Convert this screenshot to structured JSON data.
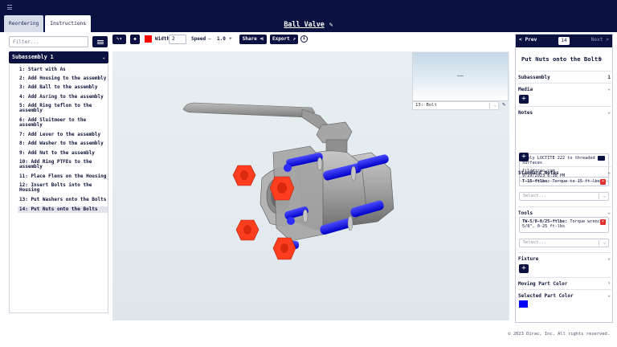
{
  "header": {
    "title": "Ball Valve",
    "tabs": [
      {
        "label": "Reordering",
        "active": false
      },
      {
        "label": "Instructions",
        "active": true
      }
    ]
  },
  "left_panel": {
    "filter_placeholder": "Filter...",
    "subassembly": "Subassembly 1",
    "steps": [
      "1: Start with As",
      "2: Add Housing to the assembly",
      "3: Add Ball to the assembly",
      "4: Add Asring to the assembly",
      "5: Add Ring teflon to the assembly",
      "6: Add Sluitmoer to the assembly",
      "7: Add Lever to the assembly",
      "8: Add Washer to the assembly",
      "9: Add Nut to the assembly",
      "10: Add Ring PTFEs to the assembly",
      "11: Place Flens on the Housing",
      "12: Insert Bolts into the Housing",
      "13: Put Washers onto the Bolts",
      "14: Put Nuts onto the Bolts"
    ],
    "active_step_index": 13
  },
  "toolbar": {
    "draw_color": "#ff0000",
    "width_label": "Width",
    "width_value": "2",
    "speed_label": "Speed",
    "speed_decrement": "–",
    "speed_value": "1.0",
    "speed_increment": "+",
    "share_label": "Share",
    "export_label": "Export"
  },
  "viewport": {
    "selected_part": "13: Bolt"
  },
  "step_panel": {
    "prev_label": "< Prev",
    "step_number": "14",
    "next_label": "Next >",
    "title": "Put Nuts onto the Bolts",
    "subassembly_label": "Subassembly",
    "subassembly_value": "1",
    "media_label": "Media",
    "notes_label": "Notes",
    "note": {
      "text": "Apply LOCTITE 222 to threaded surfaces",
      "author": "fil@dirac.com",
      "timestamp": "9/29/2023 6:38 PM"
    },
    "standard_notes_label": "Standard Notes",
    "standard_note": {
      "code": "T-15-ftlbs:",
      "text": "Torque to 15 ft-lbs"
    },
    "standard_notes_select_placeholder": "Select...",
    "tools_label": "Tools",
    "tool": {
      "code": "TW-5/8-0/25-ftlbs:",
      "text": "Torque wrench, 5/8\", 0-25 ft-lbs"
    },
    "tools_select_placeholder": "Select...",
    "fixture_label": "Fixture",
    "moving_part_color_label": "Moving Part Color",
    "selected_part_color_label": "Selected Part Color",
    "selected_part_color": "#0000ff"
  },
  "footer": {
    "copyright": "© 2023 Dirac, Inc. All rights reserved."
  },
  "colors": {
    "navy": "#0b1140",
    "nut_red": "#ff3d1f",
    "bolt_blue": "#1515f5",
    "body_gray": "#9c9c9c"
  }
}
